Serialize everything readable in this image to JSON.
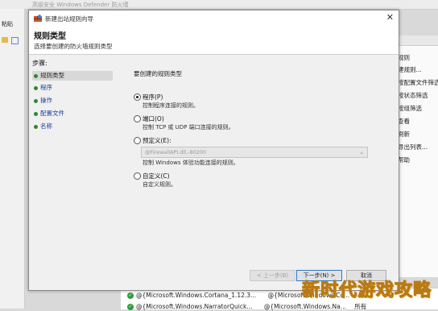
{
  "background_app": {
    "title": "高级安全 Windows Defender 防火墙",
    "left_paste": "粘贴",
    "actions": [
      "规则",
      "建规则...",
      "按配置文件筛选",
      "按状态筛选",
      "按组筛选",
      "查看",
      "刷新",
      "导出列表...",
      "帮助"
    ],
    "rules": [
      {
        "name": "@{Microsoft.Windows.Cortana_1.12.3...",
        "group": "@{Microsoft.Windows.Co..."
      },
      {
        "name": "@{Microsoft.Windows.NarratorQuick...",
        "group": "@{Microsoft.Windows.Na...",
        "profile": "所有"
      }
    ]
  },
  "dialog": {
    "title": "新建出站规则向导",
    "close": "✕",
    "heading": "规则类型",
    "subheading": "选择要创建的防火墙规则类型",
    "steps_label": "步骤:",
    "steps": [
      "规则类型",
      "程序",
      "操作",
      "配置文件",
      "名称"
    ],
    "question": "要创建的规则类型",
    "options": [
      {
        "label": "程序(P)",
        "desc": "控制程序连接的规则。",
        "selected": true
      },
      {
        "label": "端口(O)",
        "desc": "控制 TCP 或 UDP 端口连接的规则。",
        "selected": false
      },
      {
        "label": "预定义(E):",
        "desc": "控制 Windows 体验功能连接的规则。",
        "selected": false,
        "select_value": "@FirewallAPI.dll,-80200"
      },
      {
        "label": "自定义(C)",
        "desc": "自定义规则。",
        "selected": false
      }
    ],
    "buttons": {
      "back": "< 上一步(B)",
      "next": "下一步(N) >",
      "cancel": "取消"
    }
  },
  "watermark": "新时代游戏攻略"
}
